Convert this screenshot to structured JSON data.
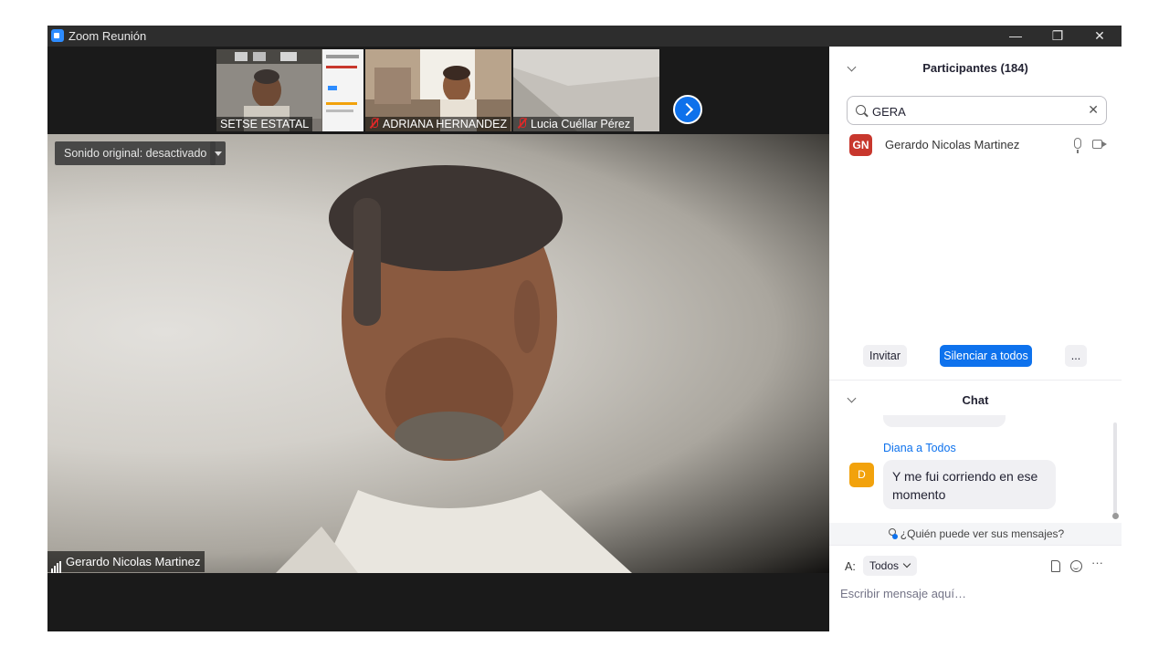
{
  "window": {
    "title": "Zoom Reunión",
    "controls": {
      "minimize": "—",
      "restore": "❐",
      "close": "✕"
    }
  },
  "thumbnails": [
    {
      "name": "SETSE ESTATAL",
      "muted": false
    },
    {
      "name": "ADRIANA HERNANDEZ",
      "muted": true
    },
    {
      "name": "Lucia Cuéllar Pérez",
      "muted": true
    }
  ],
  "main_video": {
    "audio_option": "Sonido original: desactivado",
    "speaker_name": "Gerardo Nicolas Martinez"
  },
  "participants_panel": {
    "title": "Participantes (184)",
    "search_value": "GERA",
    "participants": [
      {
        "initials": "GN",
        "name": "Gerardo Nicolas Martinez",
        "avatar_color": "#c8372d"
      }
    ],
    "buttons": {
      "invite": "Invitar",
      "mute_all": "Silenciar a todos",
      "more": "..."
    }
  },
  "chat": {
    "title": "Chat",
    "messages": [
      {
        "sender": "Diana a Todos",
        "avatar": "D",
        "avatar_color": "#f2a20c",
        "text": "Y me fui corriendo en ese momento"
      }
    ],
    "visibility_link": "¿Quién puede ver sus mensajes?",
    "to_label": "A:",
    "to_value": "Todos",
    "input_placeholder": "Escribir mensaje aquí…"
  },
  "colors": {
    "accent": "#0e72ed",
    "titlebar": "#2d2d2d",
    "video_bg": "#1a1a1a"
  }
}
